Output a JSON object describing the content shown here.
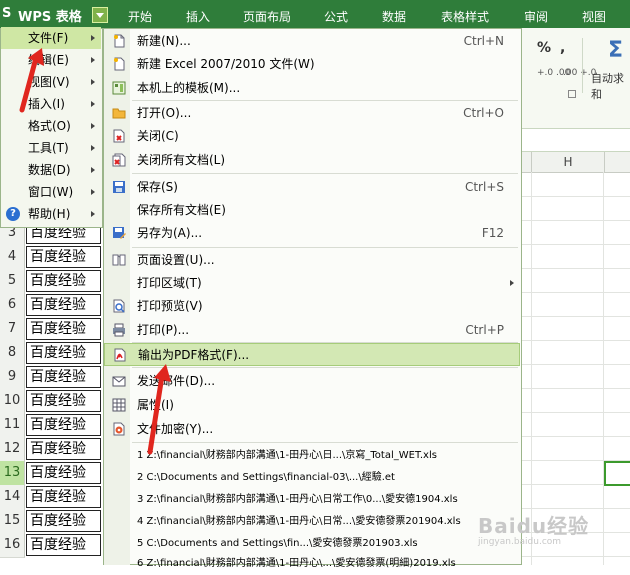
{
  "app": {
    "logo_icon": "S",
    "title": "WPS 表格"
  },
  "ribbon": {
    "tabs": [
      "开始",
      "插入",
      "页面布局",
      "公式",
      "数据",
      "表格样式",
      "审阅",
      "视图"
    ],
    "percent": "%",
    "comma": ",",
    "decimal_inc": "+.0 .00",
    "decimal_dec": ".00 +.0",
    "autosum_label": "自动求和"
  },
  "sheet": {
    "column_h": "H",
    "rows": [
      {
        "num": "3",
        "text": "百度经验"
      },
      {
        "num": "4",
        "text": "百度经验"
      },
      {
        "num": "5",
        "text": "百度经验"
      },
      {
        "num": "6",
        "text": "百度经验"
      },
      {
        "num": "7",
        "text": "百度经验"
      },
      {
        "num": "8",
        "text": "百度经验"
      },
      {
        "num": "9",
        "text": "百度经验"
      },
      {
        "num": "10",
        "text": "百度经验"
      },
      {
        "num": "11",
        "text": "百度经验"
      },
      {
        "num": "12",
        "text": "百度经验"
      },
      {
        "num": "13",
        "text": "百度经验"
      },
      {
        "num": "14",
        "text": "百度经验"
      },
      {
        "num": "15",
        "text": "百度经验"
      },
      {
        "num": "16",
        "text": "百度经验"
      }
    ]
  },
  "left_menu": [
    {
      "label": "文件(F)"
    },
    {
      "label": "编辑(E)"
    },
    {
      "label": "视图(V)"
    },
    {
      "label": "插入(I)"
    },
    {
      "label": "格式(O)"
    },
    {
      "label": "工具(T)"
    },
    {
      "label": "数据(D)"
    },
    {
      "label": "窗口(W)"
    },
    {
      "label": "帮助(H)"
    }
  ],
  "file_menu": {
    "new": {
      "label": "新建(N)...",
      "shortcut": "Ctrl+N"
    },
    "new_excel": {
      "label": "新建 Excel 2007/2010 文件(W)"
    },
    "templates": {
      "label": "本机上的模板(M)..."
    },
    "open": {
      "label": "打开(O)...",
      "shortcut": "Ctrl+O"
    },
    "close": {
      "label": "关闭(C)"
    },
    "close_all": {
      "label": "关闭所有文档(L)"
    },
    "save": {
      "label": "保存(S)",
      "shortcut": "Ctrl+S"
    },
    "save_all": {
      "label": "保存所有文档(E)"
    },
    "save_as": {
      "label": "另存为(A)...",
      "shortcut": "F12"
    },
    "page_setup": {
      "label": "页面设置(U)..."
    },
    "print_area": {
      "label": "打印区域(T)"
    },
    "print_preview": {
      "label": "打印预览(V)"
    },
    "print": {
      "label": "打印(P)...",
      "shortcut": "Ctrl+P"
    },
    "export_pdf": {
      "label": "输出为PDF格式(F)..."
    },
    "send_mail": {
      "label": "发送邮件(D)..."
    },
    "properties": {
      "label": "属性(I)"
    },
    "encrypt": {
      "label": "文件加密(Y)..."
    },
    "recent": [
      "1 Z:\\financial\\财務部内部溝通\\1-田丹心\\日...\\京寫_Total_WET.xls",
      "2 C:\\Documents and Settings\\financial-03\\...\\經驗.et",
      "3 Z:\\financial\\財務部内部溝通\\1-田丹心\\日常工作\\0...\\愛安德1904.xls",
      "4 Z:\\financial\\財務部内部溝通\\1-田丹心\\日常...\\愛安德發票201904.xls",
      "5 C:\\Documents and Settings\\fin...\\愛安德發票201903.xls",
      "6 Z:\\financial\\財務部内部溝通\\1-田丹心\\...\\愛安德發票(明細)2019.xls"
    ]
  },
  "watermark": {
    "brand": "Baidu经验",
    "url": "jingyan.baidu.com"
  },
  "colors": {
    "ribbon": "#2f7d3a",
    "highlight": "#d3e8b4",
    "arrow": "#e0261e"
  }
}
